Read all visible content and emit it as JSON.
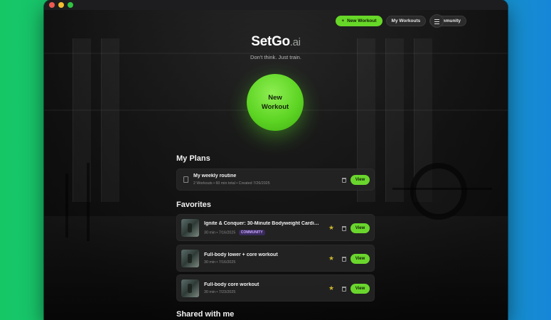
{
  "nav": {
    "new_workout": "New Workout",
    "my_workouts": "My Workouts",
    "community": "Community",
    "plus_icon": "+"
  },
  "brand": {
    "logo_main": "SetGo",
    "logo_suffix": ".ai",
    "tagline": "Don't think. Just train."
  },
  "cta": {
    "line1": "New",
    "line2": "Workout"
  },
  "sections": {
    "plans": "My Plans",
    "favorites": "Favorites",
    "shared": "Shared with me"
  },
  "plans": [
    {
      "title": "My weekly routine",
      "meta": "2 Workouts • 60 min total • Created 7/26/2025",
      "view_label": "View"
    }
  ],
  "favorites": [
    {
      "title": "Ignite & Conquer: 30-Minute Bodyweight Cardio ...",
      "meta": "30 min • 7/16/2025",
      "badge": "COMMUNITY",
      "view_label": "View"
    },
    {
      "title": "Full-body lower + core workout",
      "meta": "30 min • 7/16/2025",
      "view_label": "View"
    },
    {
      "title": "Full-body core workout",
      "meta": "30 min • 7/23/2025",
      "view_label": "View"
    }
  ],
  "colors": {
    "accent": "#67d828",
    "star": "#c9b42c",
    "badge_text": "#c7a6ff"
  }
}
